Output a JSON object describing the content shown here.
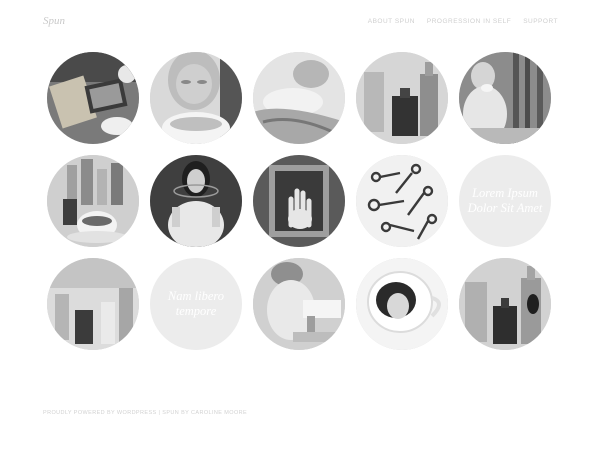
{
  "site": {
    "title": "Spun"
  },
  "nav": {
    "items": [
      "About Spun",
      "Progression in Self",
      "Support"
    ]
  },
  "tiles": [
    {
      "type": "photo",
      "name": "tile-books-teacup"
    },
    {
      "type": "photo",
      "name": "tile-woman-teacup"
    },
    {
      "type": "photo",
      "name": "tile-reclining-figure"
    },
    {
      "type": "photo",
      "name": "tile-bottles"
    },
    {
      "type": "photo",
      "name": "tile-woman-drinking"
    },
    {
      "type": "photo",
      "name": "tile-teacup-bottles"
    },
    {
      "type": "photo",
      "name": "tile-woman-hoop"
    },
    {
      "type": "photo",
      "name": "tile-framed-hand"
    },
    {
      "type": "photo",
      "name": "tile-keys"
    },
    {
      "type": "text",
      "name": "tile-lorem-ipsum",
      "caption": "Lorem Ipsum Dolor Sit Amet"
    },
    {
      "type": "photo",
      "name": "tile-glass-bottles"
    },
    {
      "type": "text",
      "name": "tile-nam-libero",
      "caption": "Nam libero tempore"
    },
    {
      "type": "photo",
      "name": "tile-woman-sewing"
    },
    {
      "type": "photo",
      "name": "tile-face-in-cup"
    },
    {
      "type": "photo",
      "name": "tile-dark-bottles"
    }
  ],
  "footer": {
    "text": "Proudly powered by WordPress | Spun by Caroline Moore"
  }
}
